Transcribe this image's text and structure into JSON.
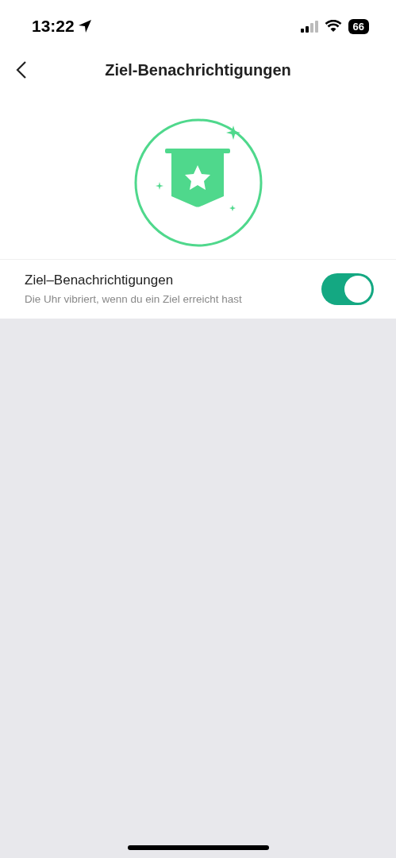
{
  "status_bar": {
    "time": "13:22",
    "battery": "66"
  },
  "header": {
    "title": "Ziel-Benachrichtigungen"
  },
  "setting": {
    "label": "Ziel–Benachrichtigungen",
    "description": "Die Uhr vibriert, wenn du ein Ziel erreicht hast",
    "on": true
  }
}
